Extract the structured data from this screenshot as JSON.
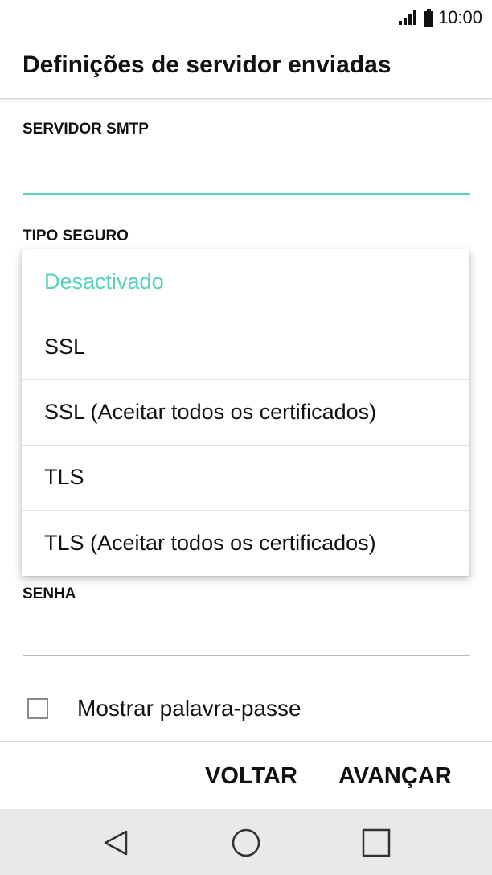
{
  "status_bar": {
    "time": "10:00",
    "signal_icon": "signal-strength-icon",
    "battery_icon": "battery-icon"
  },
  "header": {
    "title": "Definições de servidor enviadas"
  },
  "form": {
    "smtp_label": "SERVIDOR SMTP",
    "smtp_value": "",
    "security_label": "TIPO SEGURO",
    "password_label": "SENHA",
    "password_value": ""
  },
  "security_dropdown": {
    "selected_index": 0,
    "accent_color": "#58d1bd",
    "options": [
      "Desactivado",
      "SSL",
      "SSL (Aceitar todos os certificados)",
      "TLS",
      "TLS (Aceitar todos os certificados)"
    ]
  },
  "show_password": {
    "label": "Mostrar palavra-passe",
    "checked": false
  },
  "buttons": {
    "back": "VOLTAR",
    "next": "AVANÇAR"
  },
  "nav_bar": {
    "back_icon": "triangle-back-icon",
    "home_icon": "circle-home-icon",
    "recent_icon": "square-recent-apps-icon"
  }
}
